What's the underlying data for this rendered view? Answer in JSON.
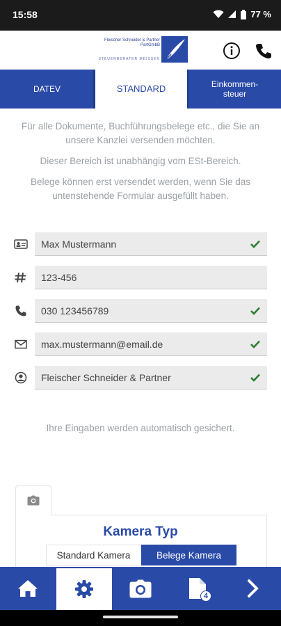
{
  "status": {
    "time": "15:58",
    "battery": "77 %"
  },
  "header": {
    "logo_firm": "Fleischer Schneider & Partner PartGmbB",
    "logo_sub": "STEUERBERATER MEISSEN",
    "info_icon": "info-icon",
    "phone_icon": "phone-icon"
  },
  "tabs": [
    {
      "label": "DATEV"
    },
    {
      "label": "STANDARD"
    },
    {
      "label": "Einkommen-steuer"
    }
  ],
  "intro": {
    "p1": "Für alle Dokumente, Buchführungsbelege etc., die Sie an unsere Kanzlei versenden möchten.",
    "p2": "Dieser Bereich ist unabhängig vom ESt-Bereich.",
    "p3": "Belege können erst versendet werden, wenn Sie das untenstehende Formular ausgefüllt haben."
  },
  "form": {
    "name": "Max Mustermann",
    "number": "123-456",
    "phone": "030 123456789",
    "email": "max.mustermann@email.de",
    "advisor": "Fleischer Schneider & Partner"
  },
  "autosave_note": "Ihre Eingaben werden automatisch gesichert.",
  "camera": {
    "title": "Kamera Typ",
    "option_standard": "Standard Kamera",
    "option_belege": "Belege Kamera"
  },
  "bottom_nav": {
    "documents_badge": "4"
  },
  "colors": {
    "primary": "#2a4aa8",
    "check": "#2e7d32"
  }
}
